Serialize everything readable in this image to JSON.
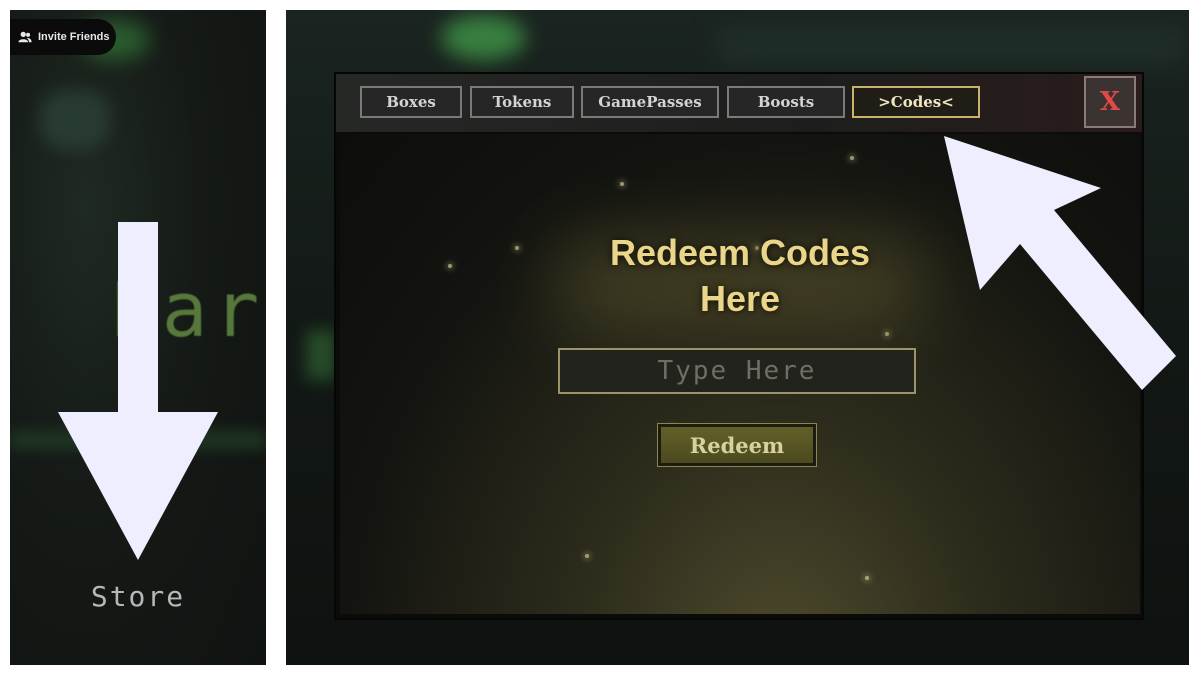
{
  "left_panel": {
    "invite_button_label": "Invite Friends",
    "background_text": "Par",
    "store_label": "Store"
  },
  "dialog": {
    "tabs": [
      {
        "label": "Boxes",
        "active": false
      },
      {
        "label": "Tokens",
        "active": false
      },
      {
        "label": "GamePasses",
        "active": false
      },
      {
        "label": "Boosts",
        "active": false
      },
      {
        "label": ">Codes<",
        "active": true
      }
    ],
    "close_label": "X",
    "title_line1": "Redeem Codes",
    "title_line2": "Here",
    "input_placeholder": "Type Here",
    "redeem_label": "Redeem"
  },
  "colors": {
    "arrow_fill": "#eeeefe",
    "title": "#e9d68a",
    "close_x": "#e14848",
    "active_tab_border": "#c9b36a"
  }
}
